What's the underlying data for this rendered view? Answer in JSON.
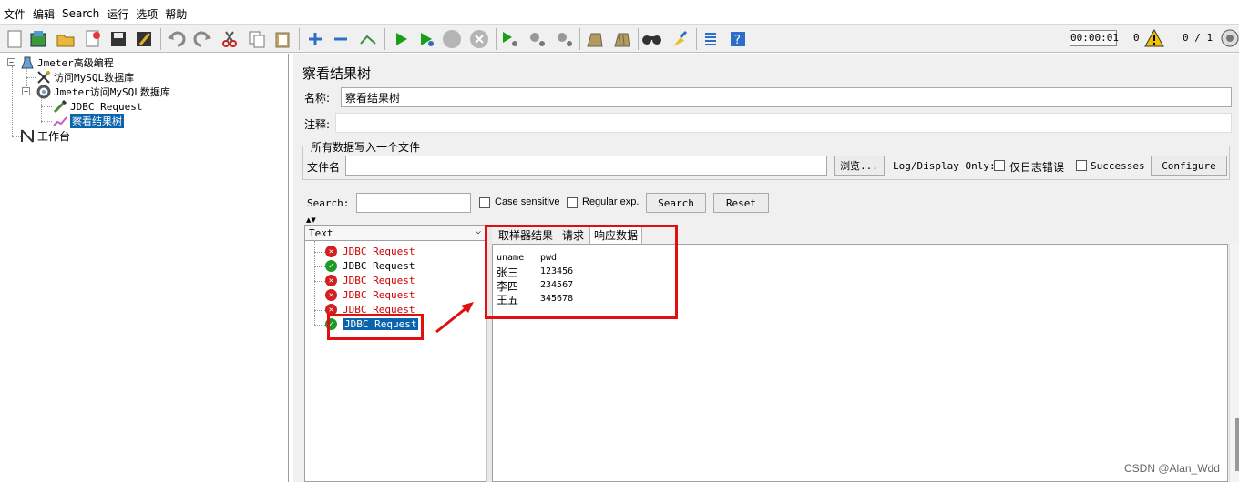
{
  "menu": [
    "文件",
    "编辑",
    "Search",
    "运行",
    "选项",
    "帮助"
  ],
  "toolbar": {
    "timer": "00:00:01",
    "warnings": "0",
    "threads": "0 / 1"
  },
  "tree": {
    "root": "Jmeter高级编程",
    "items": [
      {
        "label": "访问MySQL数据库",
        "icon": "tools-icon"
      },
      {
        "label": "Jmeter访问MySQL数据库",
        "icon": "gear-icon"
      },
      {
        "label": "JDBC Request",
        "icon": "pipette-icon"
      },
      {
        "label": "察看结果树",
        "icon": "graph-icon"
      }
    ],
    "workbench": "工作台"
  },
  "panel": {
    "title": "察看结果树",
    "name_label": "名称:",
    "name_value": "察看结果树",
    "comment_label": "注释:",
    "comment_value": "",
    "file_group_label": "所有数据写入一个文件",
    "filename_label": "文件名",
    "filename_value": "",
    "browse_button": "浏览...",
    "log_display_label": "Log/Display Only:",
    "errors_only_label": "仅日志错误",
    "successes_label": "Successes",
    "configure_button": "Configure"
  },
  "search": {
    "label": "Search:",
    "value": "",
    "case_sensitive": "Case sensitive",
    "regular_exp": "Regular exp.",
    "search_button": "Search",
    "reset_button": "Reset"
  },
  "renderer": {
    "selected": "Text"
  },
  "results": [
    {
      "label": "JDBC Request",
      "status": "error"
    },
    {
      "label": "JDBC Request",
      "status": "success"
    },
    {
      "label": "JDBC Request",
      "status": "error"
    },
    {
      "label": "JDBC Request",
      "status": "error"
    },
    {
      "label": "JDBC Request",
      "status": "error"
    },
    {
      "label": "JDBC Request",
      "status": "success",
      "selected": true
    }
  ],
  "tabs": [
    "取样器结果",
    "请求",
    "响应数据"
  ],
  "response": {
    "headers": [
      "uname",
      "pwd"
    ],
    "rows": [
      [
        "张三",
        "123456"
      ],
      [
        "李四",
        "234567"
      ],
      [
        "王五",
        "345678"
      ]
    ]
  },
  "watermark": "CSDN @Alan_Wdd",
  "colors": {
    "selection": "#0a64ad",
    "error_text": "#d00000",
    "highlight_box": "#e01010"
  }
}
